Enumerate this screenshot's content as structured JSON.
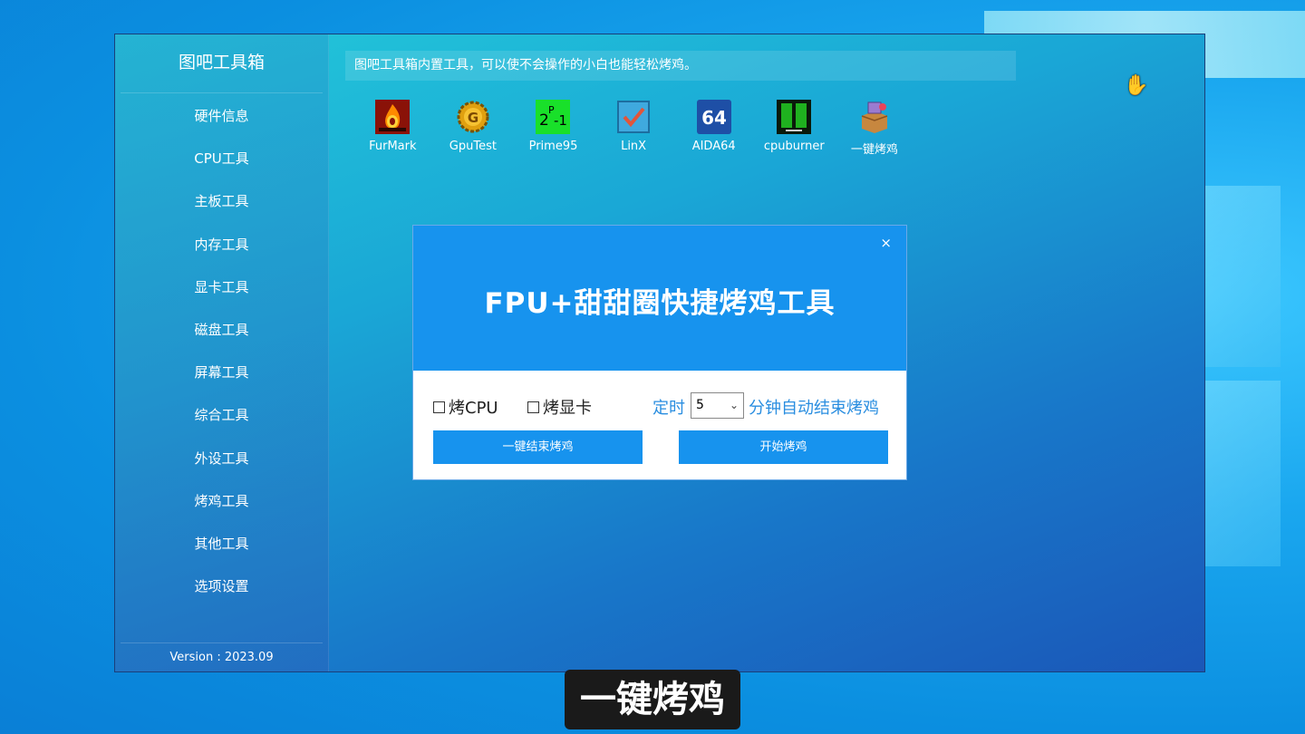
{
  "app": {
    "title": "图吧工具箱",
    "info": "图吧工具箱内置工具，可以使不会操作的小白也能轻松烤鸡。",
    "version": "Version : 2023.09"
  },
  "sidebar": {
    "items": [
      {
        "label": "硬件信息"
      },
      {
        "label": "CPU工具"
      },
      {
        "label": "主板工具"
      },
      {
        "label": "内存工具"
      },
      {
        "label": "显卡工具"
      },
      {
        "label": "磁盘工具"
      },
      {
        "label": "屏幕工具"
      },
      {
        "label": "综合工具"
      },
      {
        "label": "外设工具"
      },
      {
        "label": "烤鸡工具"
      },
      {
        "label": "其他工具"
      },
      {
        "label": "选项设置"
      }
    ]
  },
  "tools": [
    {
      "label": "FurMark",
      "icon": "furmark-icon"
    },
    {
      "label": "GpuTest",
      "icon": "gputest-icon"
    },
    {
      "label": "Prime95",
      "icon": "prime95-icon"
    },
    {
      "label": "LinX",
      "icon": "linx-icon"
    },
    {
      "label": "AIDA64",
      "icon": "aida64-icon"
    },
    {
      "label": "cpuburner",
      "icon": "cpuburner-icon"
    },
    {
      "label": "一键烤鸡",
      "icon": "one-click-burn-icon"
    }
  ],
  "dialog": {
    "title": "FPU+甜甜圈快捷烤鸡工具",
    "close": "×",
    "burn_cpu": "烤CPU",
    "burn_gpu": "烤显卡",
    "timer_label": "定时",
    "timer_value": "5",
    "timer_suffix": "分钟自动结束烤鸡",
    "stop_button": "一键结束烤鸡",
    "start_button": "开始烤鸡"
  },
  "subtitle": "一键烤鸡",
  "colors": {
    "accent": "#1793ee",
    "link": "#2a8ee0"
  }
}
